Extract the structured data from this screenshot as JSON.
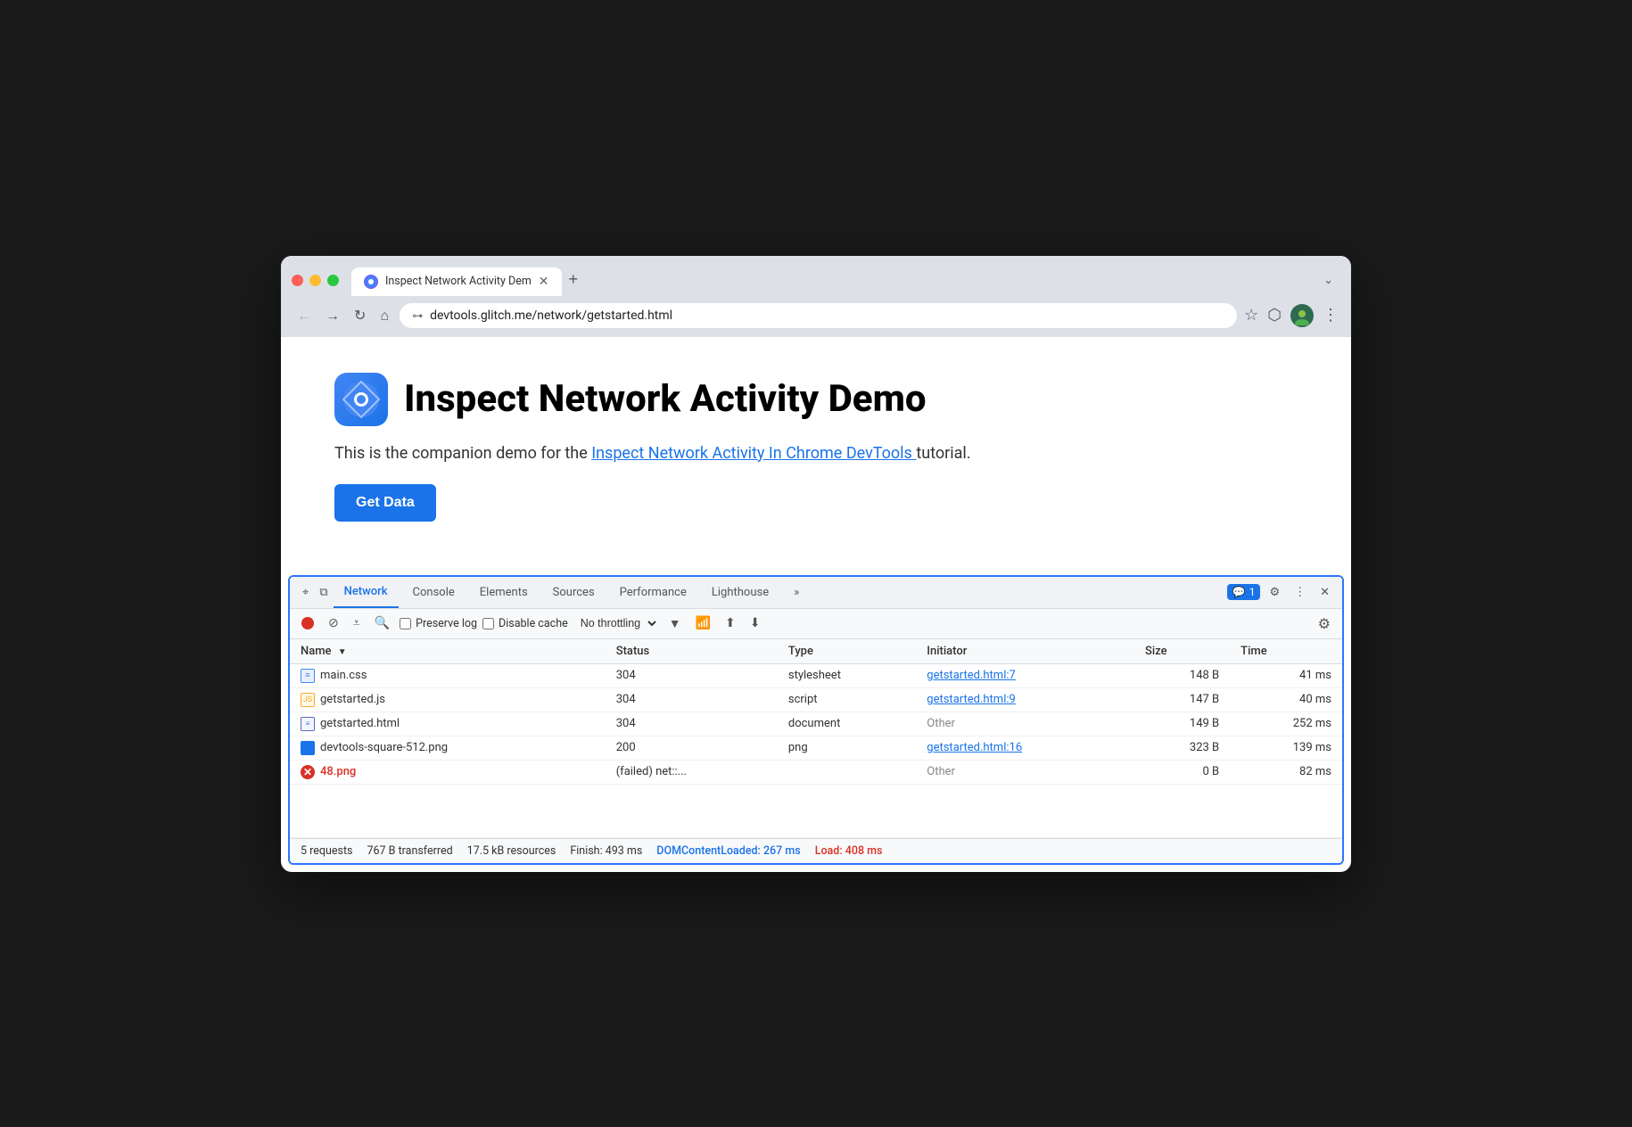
{
  "browser": {
    "tab": {
      "favicon": "⊙",
      "title": "Inspect Network Activity Dem",
      "close_label": "✕",
      "new_tab_label": "+"
    },
    "dropdown_label": "⌄",
    "nav": {
      "back_label": "←",
      "forward_label": "→",
      "reload_label": "↻",
      "home_label": "⌂"
    },
    "url": "devtools.glitch.me/network/getstarted.html",
    "bookmark_label": "☆",
    "ext_label": "⬡",
    "menu_label": "⋮"
  },
  "page": {
    "logo_label": "Chrome",
    "title": "Inspect Network Activity Demo",
    "description_prefix": "This is the companion demo for the ",
    "description_link": "Inspect Network Activity In Chrome DevTools ",
    "description_suffix": "tutorial.",
    "get_data_btn": "Get Data"
  },
  "devtools": {
    "tabs": [
      {
        "label": "Elements",
        "active": false
      },
      {
        "label": "Network",
        "active": true
      },
      {
        "label": "Console",
        "active": false
      },
      {
        "label": "Elements",
        "active": false
      },
      {
        "label": "Sources",
        "active": false
      },
      {
        "label": "Performance",
        "active": false
      },
      {
        "label": "Lighthouse",
        "active": false
      }
    ],
    "tabs_list": [
      "Network",
      "Console",
      "Elements",
      "Sources",
      "Performance",
      "Lighthouse"
    ],
    "more_label": "»",
    "chat_badge": "1",
    "settings_label": "⚙",
    "dots_label": "⋮",
    "close_label": "✕",
    "network_toolbar": {
      "record_stop": "⏺",
      "clear": "⊘",
      "filter": "⩡",
      "search": "🔍",
      "preserve_log": "Preserve log",
      "disable_cache": "Disable cache",
      "throttling": "No throttling",
      "wifi_label": "📶",
      "upload_label": "⬆",
      "download_label": "⬇",
      "gear_label": "⚙"
    },
    "table": {
      "columns": [
        "Name",
        "Status",
        "Type",
        "Initiator",
        "Size",
        "Time"
      ],
      "rows": [
        {
          "icon_type": "css",
          "name": "main.css",
          "status": "304",
          "type": "stylesheet",
          "initiator": "getstarted.html:7",
          "initiator_link": true,
          "size": "148 B",
          "time": "41 ms",
          "error": false
        },
        {
          "icon_type": "js",
          "name": "getstarted.js",
          "status": "304",
          "type": "script",
          "initiator": "getstarted.html:9",
          "initiator_link": true,
          "size": "147 B",
          "time": "40 ms",
          "error": false
        },
        {
          "icon_type": "html",
          "name": "getstarted.html",
          "status": "304",
          "type": "document",
          "initiator": "Other",
          "initiator_link": false,
          "size": "149 B",
          "time": "252 ms",
          "error": false
        },
        {
          "icon_type": "png",
          "name": "devtools-square-512.png",
          "status": "200",
          "type": "png",
          "initiator": "getstarted.html:16",
          "initiator_link": true,
          "size": "323 B",
          "time": "139 ms",
          "error": false
        },
        {
          "icon_type": "error",
          "name": "48.png",
          "status": "(failed)  net::...",
          "type": "",
          "initiator": "Other",
          "initiator_link": false,
          "size": "0 B",
          "time": "82 ms",
          "error": true
        }
      ]
    },
    "status_bar": {
      "requests": "5 requests",
      "transferred": "767 B transferred",
      "resources": "17.5 kB resources",
      "finish": "Finish: 493 ms",
      "dom_loaded": "DOMContentLoaded: 267 ms",
      "load": "Load: 408 ms"
    }
  }
}
